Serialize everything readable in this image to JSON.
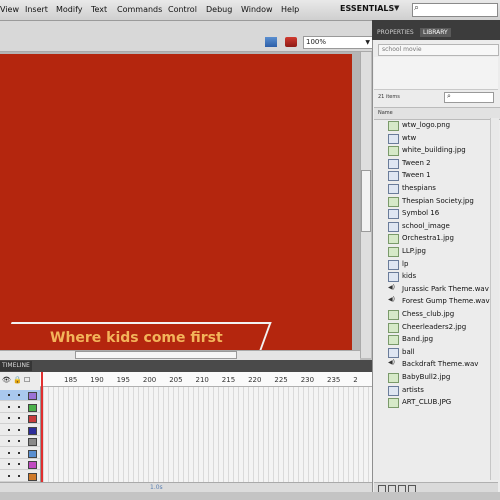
{
  "menubar": {
    "items": [
      "View",
      "Insert",
      "Modify",
      "Text",
      "Commands",
      "Control",
      "Debug",
      "Window",
      "Help"
    ],
    "workspace": "ESSENTIALS"
  },
  "toolbar": {
    "zoom": "100%"
  },
  "stage": {
    "banner_text": "Where kids come first",
    "background_color": "#b4260e"
  },
  "timeline": {
    "tab_label": "TIMELINE",
    "frame_numbers": [
      "185",
      "190",
      "195",
      "200",
      "205",
      "210",
      "215",
      "220",
      "225",
      "230",
      "235",
      "2"
    ],
    "layer_colors": [
      "#9a72d6",
      "#4ab04a",
      "#c83c3c",
      "#2d2d9a",
      "#8a8a8a",
      "#5a8fd0",
      "#c04ac0",
      "#d07a2a"
    ],
    "footer": "1.0s"
  },
  "panel": {
    "tabs": [
      "PROPERTIES",
      "LIBRARY"
    ],
    "library_name": "school movie",
    "items_count": "21 items",
    "name_header": "Name",
    "items": [
      {
        "name": "wtw_logo.png",
        "type": "bitmap"
      },
      {
        "name": "wtw",
        "type": "symbol"
      },
      {
        "name": "white_building.jpg",
        "type": "bitmap"
      },
      {
        "name": "Tween 2",
        "type": "symbol"
      },
      {
        "name": "Tween 1",
        "type": "symbol"
      },
      {
        "name": "thespians",
        "type": "symbol"
      },
      {
        "name": "Thespian Society.jpg",
        "type": "bitmap"
      },
      {
        "name": "Symbol 16",
        "type": "symbol"
      },
      {
        "name": "school_image",
        "type": "symbol"
      },
      {
        "name": "Orchestra1.jpg",
        "type": "bitmap"
      },
      {
        "name": "LLP.jpg",
        "type": "bitmap"
      },
      {
        "name": "lp",
        "type": "symbol"
      },
      {
        "name": "kids",
        "type": "symbol"
      },
      {
        "name": "Jurassic Park Theme.wav",
        "type": "sound"
      },
      {
        "name": "Forest Gump Theme.wav",
        "type": "sound"
      },
      {
        "name": "Chess_club.jpg",
        "type": "bitmap"
      },
      {
        "name": "Cheerleaders2.jpg",
        "type": "bitmap"
      },
      {
        "name": "Band.jpg",
        "type": "bitmap"
      },
      {
        "name": "ball",
        "type": "symbol"
      },
      {
        "name": "Backdraft Theme.wav",
        "type": "sound"
      },
      {
        "name": "BabyBull2.jpg",
        "type": "bitmap"
      },
      {
        "name": "artists",
        "type": "symbol"
      },
      {
        "name": "ART_CLUB.JPG",
        "type": "bitmap"
      }
    ]
  }
}
